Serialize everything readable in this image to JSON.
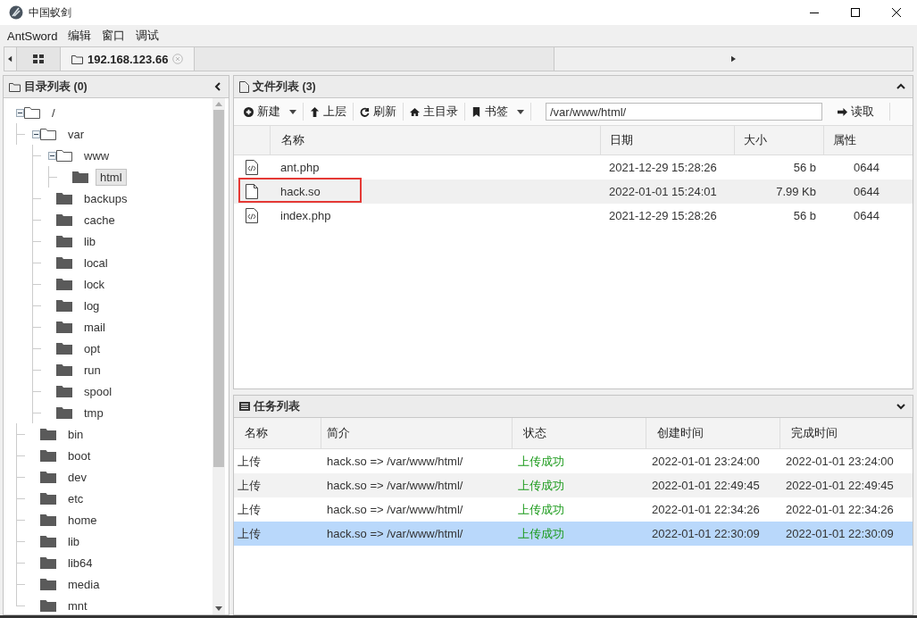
{
  "window": {
    "title": "中国蚁剑"
  },
  "menu": [
    "AntSword",
    "编辑",
    "窗口",
    "调试"
  ],
  "tabs": [
    {
      "kind": "grid",
      "selected": false
    },
    {
      "kind": "folder",
      "label": "192.168.123.66",
      "selected": true
    }
  ],
  "directory_panel": {
    "title": "目录列表 (0)",
    "tree": [
      {
        "label": "/",
        "expanded": true,
        "selected": false,
        "children": [
          {
            "label": "var",
            "expanded": true,
            "selected": false,
            "children": [
              {
                "label": "www",
                "expanded": true,
                "selected": false,
                "children": [
                  {
                    "label": "html",
                    "expanded": false,
                    "selected": true
                  }
                ]
              },
              {
                "label": "backups",
                "expanded": false,
                "selected": false
              },
              {
                "label": "cache",
                "expanded": false,
                "selected": false
              },
              {
                "label": "lib",
                "expanded": false,
                "selected": false
              },
              {
                "label": "local",
                "expanded": false,
                "selected": false
              },
              {
                "label": "lock",
                "expanded": false,
                "selected": false
              },
              {
                "label": "log",
                "expanded": false,
                "selected": false
              },
              {
                "label": "mail",
                "expanded": false,
                "selected": false
              },
              {
                "label": "opt",
                "expanded": false,
                "selected": false
              },
              {
                "label": "run",
                "expanded": false,
                "selected": false
              },
              {
                "label": "spool",
                "expanded": false,
                "selected": false
              },
              {
                "label": "tmp",
                "expanded": false,
                "selected": false
              }
            ]
          },
          {
            "label": "bin",
            "expanded": false,
            "selected": false
          },
          {
            "label": "boot",
            "expanded": false,
            "selected": false
          },
          {
            "label": "dev",
            "expanded": false,
            "selected": false
          },
          {
            "label": "etc",
            "expanded": false,
            "selected": false
          },
          {
            "label": "home",
            "expanded": false,
            "selected": false
          },
          {
            "label": "lib",
            "expanded": false,
            "selected": false
          },
          {
            "label": "lib64",
            "expanded": false,
            "selected": false
          },
          {
            "label": "media",
            "expanded": false,
            "selected": false
          },
          {
            "label": "mnt",
            "expanded": false,
            "selected": false
          }
        ]
      }
    ]
  },
  "file_panel": {
    "title": "文件列表 (3)",
    "toolbar": [
      {
        "kind": "new",
        "label": "新建",
        "dropdown": true
      },
      {
        "kind": "up",
        "label": "上层",
        "dropdown": false
      },
      {
        "kind": "refresh",
        "label": "刷新",
        "dropdown": false
      },
      {
        "kind": "home",
        "label": "主目录",
        "dropdown": false
      },
      {
        "kind": "bookmark",
        "label": "书签",
        "dropdown": true
      }
    ],
    "path": "/var/www/html/",
    "read_button": "读取",
    "columns": [
      "名称",
      "日期",
      "大小",
      "属性"
    ],
    "rows": [
      {
        "kind": "code",
        "name": "ant.php",
        "date": "2021-12-29 15:28:26",
        "size": "56 b",
        "mode": "0644",
        "selected": false,
        "boxed": false
      },
      {
        "kind": "file",
        "name": "hack.so",
        "date": "2022-01-01 15:24:01",
        "size": "7.99 Kb",
        "mode": "0644",
        "selected": true,
        "boxed": true
      },
      {
        "kind": "code",
        "name": "index.php",
        "date": "2021-12-29 15:28:26",
        "size": "56 b",
        "mode": "0644",
        "selected": false,
        "boxed": false
      }
    ]
  },
  "task_panel": {
    "title": "任务列表",
    "columns": [
      "名称",
      "简介",
      "状态",
      "创建时间",
      "完成时间"
    ],
    "rows": [
      {
        "name": "上传",
        "summary": "hack.so => /var/www/html/",
        "status": "上传成功",
        "created": "2022-01-01 23:24:00",
        "finished": "2022-01-01 23:24:00",
        "selected": false
      },
      {
        "name": "上传",
        "summary": "hack.so => /var/www/html/",
        "status": "上传成功",
        "created": "2022-01-01 22:49:45",
        "finished": "2022-01-01 22:49:45",
        "selected": false
      },
      {
        "name": "上传",
        "summary": "hack.so => /var/www/html/",
        "status": "上传成功",
        "created": "2022-01-01 22:34:26",
        "finished": "2022-01-01 22:34:26",
        "selected": false
      },
      {
        "name": "上传",
        "summary": "hack.so => /var/www/html/",
        "status": "上传成功",
        "created": "2022-01-01 22:30:09",
        "finished": "2022-01-01 22:30:09",
        "selected": true
      }
    ]
  }
}
